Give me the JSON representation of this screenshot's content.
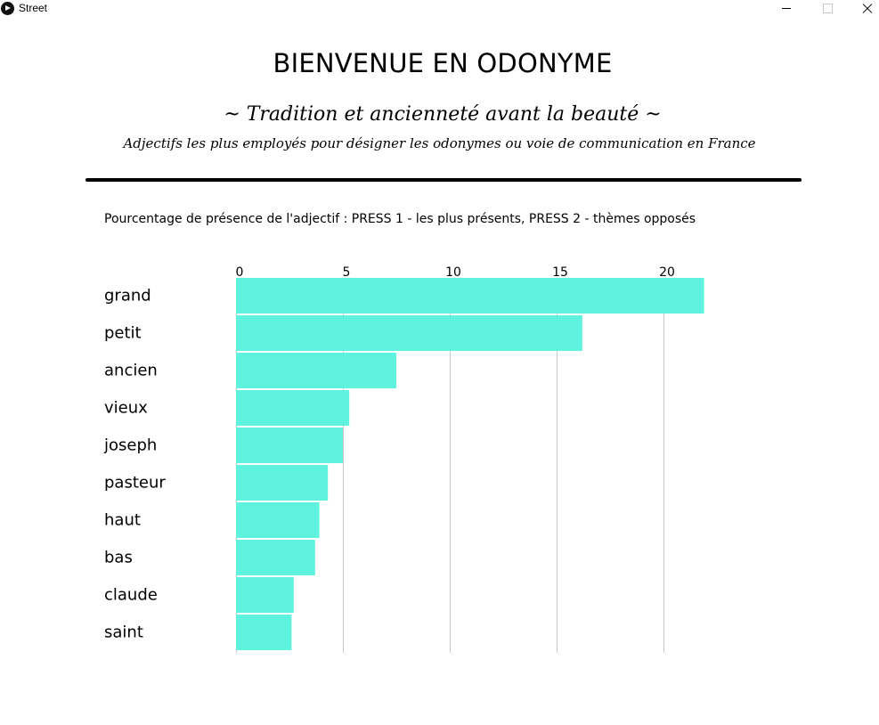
{
  "window": {
    "title": "Street"
  },
  "header": {
    "title": "BIENVENUE EN ODONYME",
    "subtitle": "~ Tradition et ancienneté avant la beauté ~",
    "description": "Adjectifs les plus employés pour désigner les odonymes ou voie de communication en France"
  },
  "instructions": "Pourcentage de présence de l'adjectif : PRESS 1 - les plus présents, PRESS 2 - thèmes opposés",
  "colors": {
    "bar": "#5ef2df",
    "grid": "#c8c8c8",
    "divider": "#000000"
  },
  "chart_data": {
    "type": "bar",
    "orientation": "horizontal",
    "categories": [
      "grand",
      "petit",
      "ancien",
      "vieux",
      "joseph",
      "pasteur",
      "haut",
      "bas",
      "claude",
      "saint"
    ],
    "values": [
      21.9,
      16.2,
      7.5,
      5.3,
      5.0,
      4.3,
      3.9,
      3.7,
      2.7,
      2.6
    ],
    "xticks": [
      0,
      5,
      10,
      15,
      20
    ],
    "xlim": [
      0,
      22
    ],
    "grid": true,
    "legend": "none"
  }
}
